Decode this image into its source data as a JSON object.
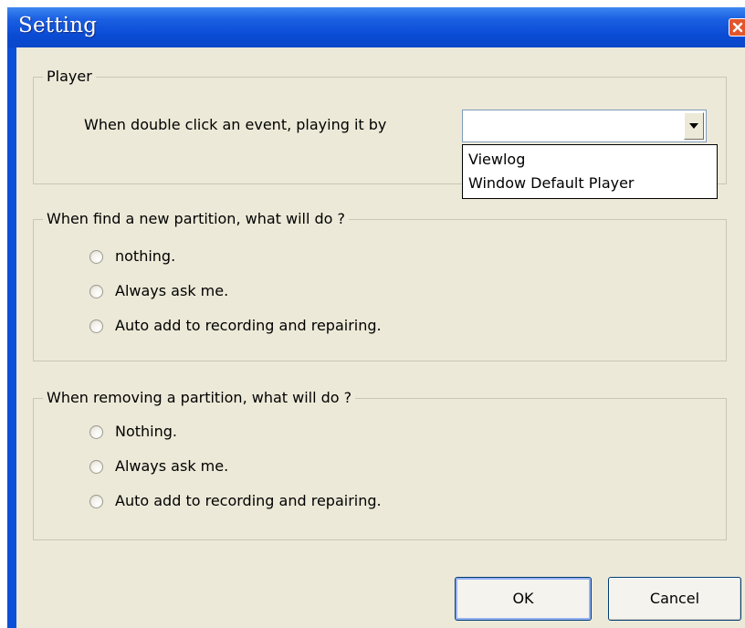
{
  "window": {
    "title": "Setting",
    "close_icon": "close-icon"
  },
  "player": {
    "legend": "Player",
    "prompt": "When double click an event,  playing it by",
    "combo_value": "",
    "options": [
      "Viewlog",
      "Window Default Player"
    ]
  },
  "new_partition": {
    "legend": "When find a new partition, what will do ?",
    "options": [
      "nothing.",
      "Always ask me.",
      "Auto add to recording and repairing."
    ]
  },
  "remove_partition": {
    "legend": "When removing a partition, what will do ?",
    "options": [
      "Nothing.",
      "Always ask me.",
      "Auto add to recording and repairing."
    ]
  },
  "buttons": {
    "ok": "OK",
    "cancel": "Cancel"
  },
  "colors": {
    "titlebar": "#0a4fd8",
    "dialog_bg": "#ece9d8",
    "close_button": "#e2562c"
  }
}
